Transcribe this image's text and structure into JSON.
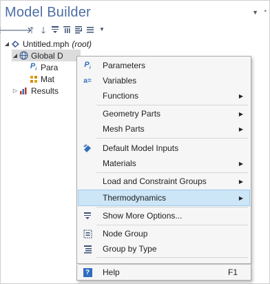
{
  "window": {
    "title": "Model Builder"
  },
  "tree": {
    "root": {
      "name": "Untitled.mph",
      "suffix": "(root)"
    },
    "global": {
      "label": "Global Definitions",
      "visible_label": "Global D"
    },
    "parameters": {
      "label": "Para"
    },
    "materials": {
      "label": "Mat"
    },
    "results": {
      "label": "Results"
    }
  },
  "context_menu": {
    "items": [
      {
        "id": "parameters",
        "label": "Parameters",
        "icon": "parameters-icon",
        "submenu": false
      },
      {
        "id": "variables",
        "label": "Variables",
        "icon": "variables-icon",
        "submenu": false
      },
      {
        "id": "functions",
        "label": "Functions",
        "submenu": true
      },
      {
        "id": "geometry-parts",
        "label": "Geometry Parts",
        "submenu": true
      },
      {
        "id": "mesh-parts",
        "label": "Mesh Parts",
        "submenu": true
      },
      {
        "id": "default-model-inputs",
        "label": "Default Model Inputs",
        "icon": "model-inputs-icon",
        "submenu": false
      },
      {
        "id": "materials",
        "label": "Materials",
        "submenu": true
      },
      {
        "id": "load-constraint-groups",
        "label": "Load and Constraint Groups",
        "submenu": true
      },
      {
        "id": "thermodynamics",
        "label": "Thermodynamics",
        "submenu": true,
        "highlighted": true
      },
      {
        "id": "show-more-options",
        "label": "Show More Options...",
        "icon": "show-more-options-icon",
        "submenu": false
      },
      {
        "id": "node-group",
        "label": "Node Group",
        "icon": "node-group-icon",
        "submenu": false
      },
      {
        "id": "group-by-type",
        "label": "Group by Type",
        "icon": "group-by-type-icon",
        "submenu": false
      },
      {
        "id": "help",
        "label": "Help",
        "icon": "help-icon",
        "shortcut": "F1",
        "submenu": false
      }
    ]
  },
  "colors": {
    "title": "#4d6ea3",
    "highlight": "#cce5f7",
    "menu_bg": "#f6f6f6"
  }
}
